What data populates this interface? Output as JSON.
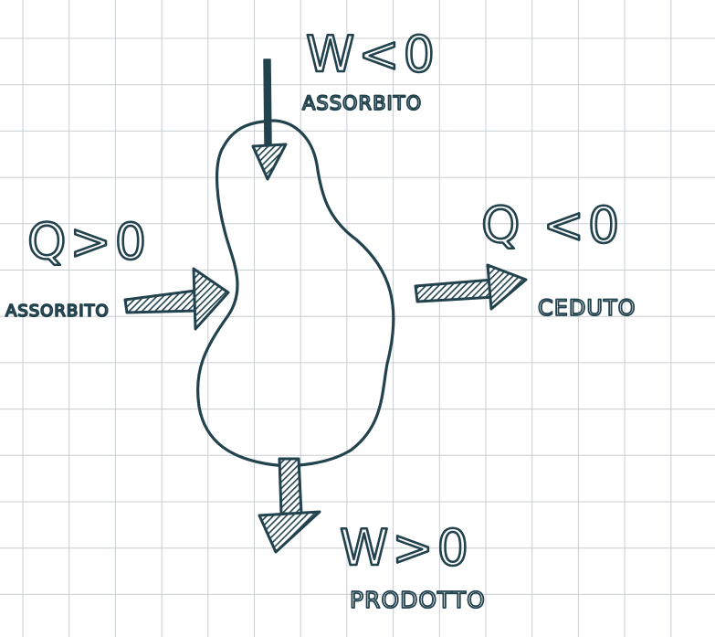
{
  "colors": {
    "background": "#ffffff",
    "grid": "#c9ced2",
    "ink": "#22424e"
  },
  "labels": {
    "work_in": {
      "expr": "W<0",
      "desc": "ASSORBITO"
    },
    "heat_in": {
      "expr": "Q>0",
      "desc": "ASSORBITO"
    },
    "heat_out": {
      "expr": "Q <0",
      "desc": "CEDUTO"
    },
    "work_out": {
      "expr": "W>0",
      "desc": "PRODOTTO"
    }
  }
}
